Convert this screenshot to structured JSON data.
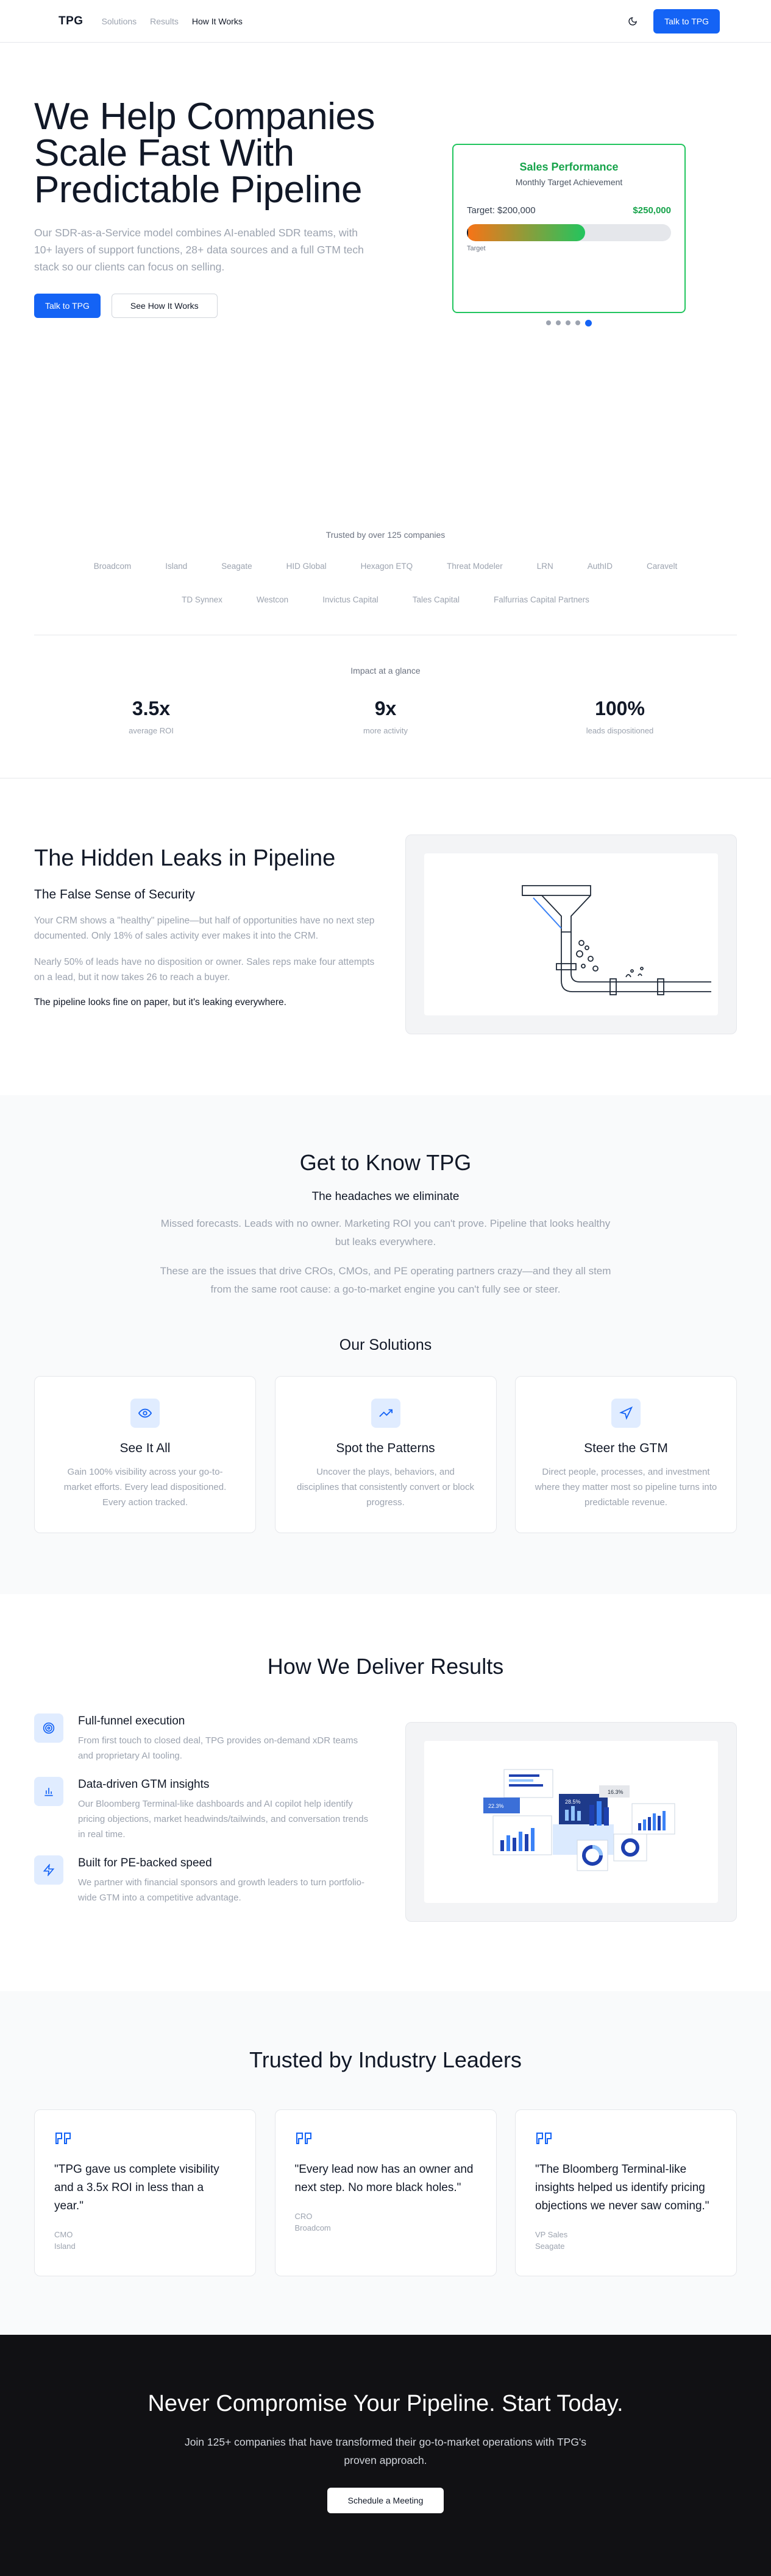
{
  "nav": {
    "logo": "TPG",
    "links": [
      "Solutions",
      "Results",
      "How It Works"
    ],
    "theme_icon": "moon-icon",
    "cta": "Talk to TPG"
  },
  "hero": {
    "title": "We Help Companies Scale Fast With Predictable Pipeline",
    "description": "Our SDR-as-a-Service model combines AI-enabled SDR teams, with 10+ layers of support functions, 28+ data sources and a full GTM tech stack so our clients can focus on selling.",
    "primary_btn": "Talk to TPG",
    "secondary_btn": "See How It Works",
    "card": {
      "title": "Sales Performance",
      "subtitle": "Monthly Target Achievement",
      "target_label": "Target: $200,000",
      "value": "$250,000",
      "bar_label": "Target",
      "progress_pct": 58,
      "slides": 5,
      "active_slide": 5
    }
  },
  "trusted": {
    "heading": "Trusted by over 125 companies",
    "row1": [
      "Broadcom",
      "Island",
      "Seagate",
      "HID Global",
      "Hexagon ETQ",
      "Threat Modeler",
      "LRN",
      "AuthID",
      "Caravelt"
    ],
    "row2": [
      "TD Synnex",
      "Westcon",
      "Invictus Capital",
      "Tales Capital",
      "Falfurrias Capital Partners"
    ]
  },
  "impact": {
    "heading": "Impact at a glance",
    "stats": [
      {
        "num": "3.5x",
        "label": "average ROI"
      },
      {
        "num": "9x",
        "label": "more activity"
      },
      {
        "num": "100%",
        "label": "leads dispositioned"
      }
    ]
  },
  "leaks": {
    "title": "The Hidden Leaks in Pipeline",
    "subtitle": "The False Sense of Security",
    "p1": "Your CRM shows a \"healthy\" pipeline—but half of opportunities have no next step documented. Only 18% of sales activity ever makes it into the CRM.",
    "p2": "Nearly 50% of leads have no disposition or owner. Sales reps make four attempts on a lead, but it now takes 26 to reach a buyer.",
    "strong": "The pipeline looks fine on paper, but it's leaking everywhere."
  },
  "know": {
    "title": "Get to Know TPG",
    "subtitle": "The headaches we eliminate",
    "p1": "Missed forecasts. Leads with no owner. Marketing ROI you can't prove. Pipeline that looks healthy but leaks everywhere.",
    "p2": "These are the issues that drive CROs, CMOs, and PE operating partners crazy—and they all stem from the same root cause: a go-to-market engine you can't fully see or steer.",
    "solutions_title": "Our Solutions",
    "cards": [
      {
        "icon": "eye-icon",
        "title": "See It All",
        "text": "Gain 100% visibility across your go-to-market efforts. Every lead dispositioned. Every action tracked."
      },
      {
        "icon": "trending-up-icon",
        "title": "Spot the Patterns",
        "text": "Uncover the plays, behaviors, and disciplines that consistently convert or block progress."
      },
      {
        "icon": "navigation-icon",
        "title": "Steer the GTM",
        "text": "Direct people, processes, and investment where they matter most so pipeline turns into predictable revenue."
      }
    ]
  },
  "deliver": {
    "title": "How We Deliver Results",
    "features": [
      {
        "icon": "target-icon",
        "title": "Full-funnel execution",
        "text": "From first touch to closed deal, TPG provides on-demand xDR teams and proprietary AI tooling."
      },
      {
        "icon": "bar-chart-icon",
        "title": "Data-driven GTM insights",
        "text": "Our Bloomberg Terminal-like dashboards and AI copilot help identify pricing objections, market headwinds/tailwinds, and conversation trends in real time."
      },
      {
        "icon": "lightning-icon",
        "title": "Built for PE-backed speed",
        "text": "We partner with financial sponsors and growth leaders to turn portfolio-wide GTM into a competitive advantage."
      }
    ],
    "dash_labels": [
      "22.3%",
      "28.5%",
      "16.3%"
    ]
  },
  "testimonials": {
    "title": "Trusted by Industry Leaders",
    "items": [
      {
        "quote": "\"TPG gave us complete visibility and a 3.5x ROI in less than a year.\"",
        "role": "CMO",
        "company": "Island"
      },
      {
        "quote": "\"Every lead now has an owner and next step. No more black holes.\"",
        "role": "CRO",
        "company": "Broadcom"
      },
      {
        "quote": "\"The Bloomberg Terminal-like insights helped us identify pricing objections we never saw coming.\"",
        "role": "VP Sales",
        "company": "Seagate"
      }
    ]
  },
  "cta": {
    "title": "Never Compromise Your Pipeline. Start Today.",
    "text": "Join 125+ companies that have transformed their go-to-market operations with TPG's proven approach.",
    "button": "Schedule a Meeting"
  },
  "colors": {
    "accent": "#1463f5",
    "success": "#16a34a",
    "dark": "#111114"
  }
}
